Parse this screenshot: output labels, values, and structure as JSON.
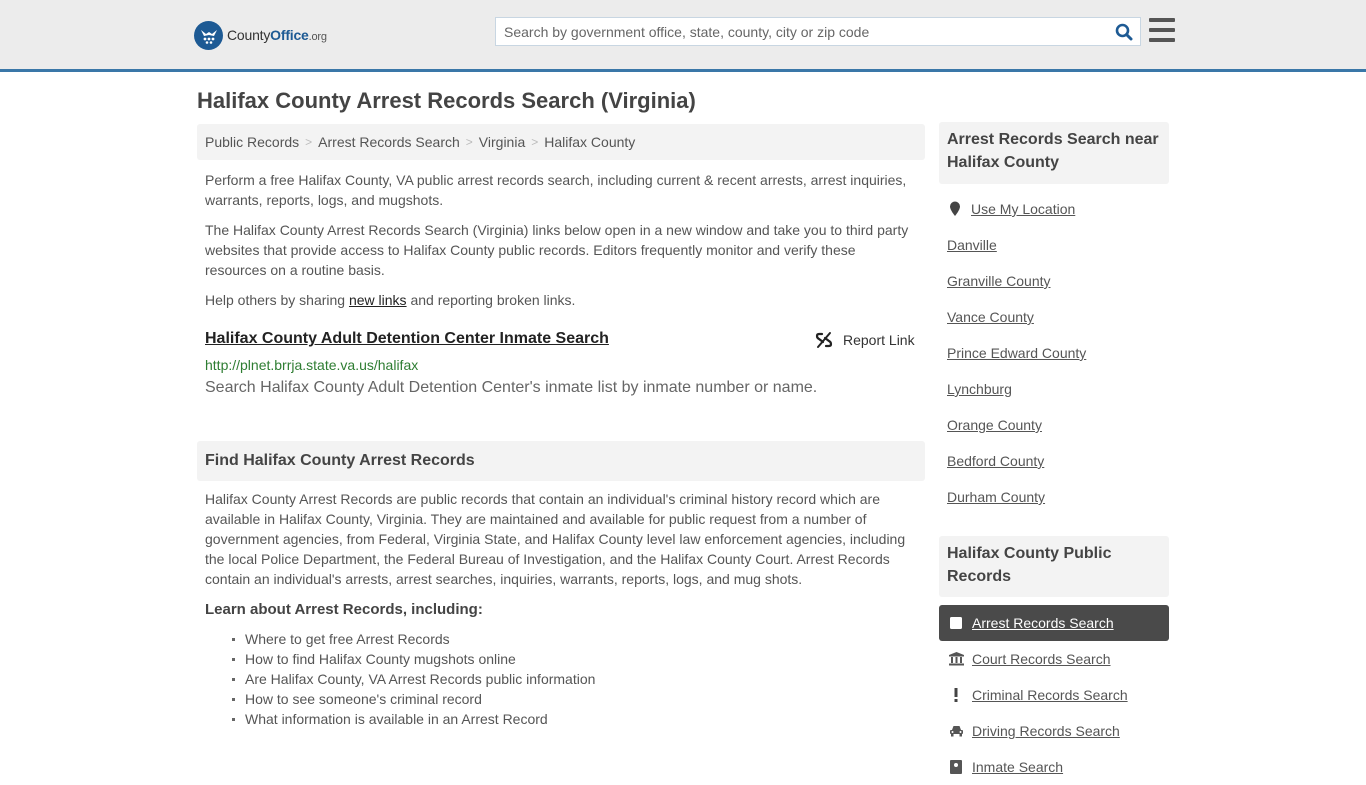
{
  "header": {
    "logo": {
      "name_main": "County",
      "name_accent": "Office",
      "name_suffix": ".org"
    },
    "search": {
      "placeholder": "Search by government office, state, county, city or zip code",
      "value": ""
    },
    "icons": {
      "search": "search-icon",
      "menu": "hamburger-menu-icon"
    }
  },
  "page": {
    "title": "Halifax County Arrest Records Search (Virginia)",
    "breadcrumb": [
      "Public Records",
      "Arrest Records Search",
      "Virginia",
      "Halifax County"
    ],
    "intro": "Perform a free Halifax County, VA public arrest records search, including current & recent arrests, arrest inquiries, warrants, reports, logs, and mugshots.",
    "disclaimer": "The Halifax County Arrest Records Search (Virginia) links below open in a new window and take you to third party websites that provide access to Halifax County public records. Editors frequently monitor and verify these resources on a routine basis.",
    "help_prefix": "Help others by sharing ",
    "help_link": "new links",
    "help_suffix": " and reporting broken links."
  },
  "results": [
    {
      "title": "Halifax County Adult Detention Center Inmate Search",
      "url": "http://plnet.brrja.state.va.us/halifax",
      "description": "Search Halifax County Adult Detention Center's inmate list by inmate number or name.",
      "report_label": "Report Link"
    }
  ],
  "find_section": {
    "heading": "Find Halifax County Arrest Records",
    "body": "Halifax County Arrest Records are public records that contain an individual's criminal history record which are available in Halifax County, Virginia. They are maintained and available for public request from a number of government agencies, from Federal, Virginia State, and Halifax County level law enforcement agencies, including the local Police Department, the Federal Bureau of Investigation, and the Halifax County Court. Arrest Records contain an individual's arrests, arrest searches, inquiries, warrants, reports, logs, and mug shots.",
    "learn_heading": "Learn about Arrest Records, including:",
    "learn_items": [
      "Where to get free Arrest Records",
      "How to find Halifax County mugshots online",
      "Are Halifax County, VA Arrest Records public information",
      "How to see someone's criminal record",
      "What information is available in an Arrest Record"
    ]
  },
  "sidebar": {
    "nearby_heading": "Arrest Records Search near Halifax County",
    "use_location": "Use My Location",
    "nearby": [
      "Danville",
      "Granville County",
      "Vance County",
      "Prince Edward County",
      "Lynchburg",
      "Orange County",
      "Bedford County",
      "Durham County"
    ],
    "public_records_heading": "Halifax County Public Records",
    "records": [
      {
        "label": "Arrest Records Search",
        "icon": "square-icon",
        "active": true
      },
      {
        "label": "Court Records Search",
        "icon": "courthouse-icon",
        "active": false
      },
      {
        "label": "Criminal Records Search",
        "icon": "exclamation-icon",
        "active": false
      },
      {
        "label": "Driving Records Search",
        "icon": "car-icon",
        "active": false
      },
      {
        "label": "Inmate Search",
        "icon": "inmate-icon",
        "active": false
      }
    ]
  },
  "colors": {
    "brand": "#1d5a94",
    "header_border": "#3a77a8",
    "url_green": "#2e7d32",
    "active_item": "#4a4a4a"
  }
}
